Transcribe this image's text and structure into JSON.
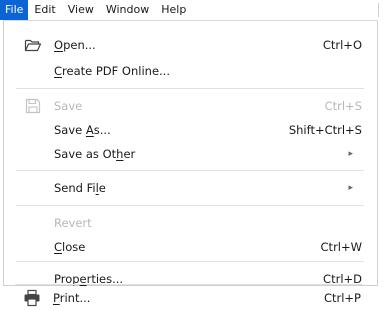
{
  "menubar": {
    "items": [
      "File",
      "Edit",
      "View",
      "Window",
      "Help"
    ]
  },
  "menu": {
    "items": [
      {
        "pre": "",
        "u": "O",
        "post": "pen...",
        "shortcut": "Ctrl+O"
      },
      {
        "pre": "",
        "u": "C",
        "post": "reate PDF Online...",
        "shortcut": ""
      },
      {
        "pre": "Save",
        "u": "",
        "post": "",
        "shortcut": "Ctrl+S"
      },
      {
        "pre": "Save ",
        "u": "A",
        "post": "s...",
        "shortcut": "Shift+Ctrl+S"
      },
      {
        "pre": "Save as Ot",
        "u": "h",
        "post": "er",
        "shortcut": "▸"
      },
      {
        "pre": "Send Fi",
        "u": "l",
        "post": "e",
        "shortcut": "▸"
      },
      {
        "pre": "Revert",
        "u": "",
        "post": "",
        "shortcut": ""
      },
      {
        "pre": "",
        "u": "C",
        "post": "lose",
        "shortcut": "Ctrl+W"
      },
      {
        "pre": "Prop",
        "u": "e",
        "post": "rties...",
        "shortcut": "Ctrl+D"
      },
      {
        "pre": "",
        "u": "P",
        "post": "rint...",
        "shortcut": "Ctrl+P"
      }
    ]
  }
}
